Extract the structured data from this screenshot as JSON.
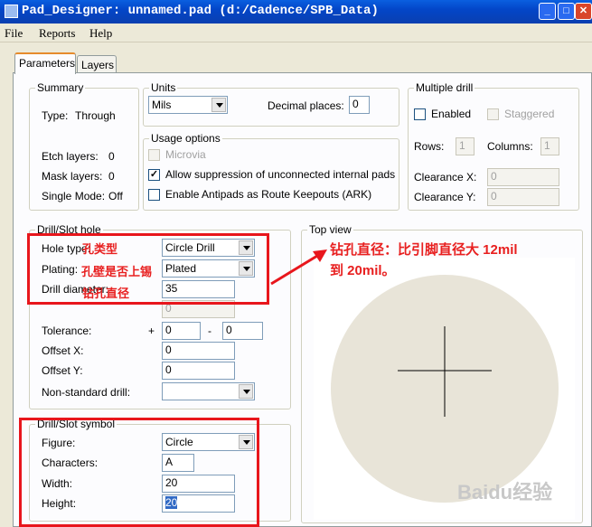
{
  "window": {
    "title": "Pad_Designer: unnamed.pad (d:/Cadence/SPB_Data)",
    "buttons": {
      "minimize": "_",
      "maximize": "□",
      "close": "✕"
    }
  },
  "menu": [
    "File",
    "Reports",
    "Help"
  ],
  "tabs": [
    "Parameters",
    "Layers"
  ],
  "summary": {
    "legend": "Summary",
    "type_label": "Type:",
    "type_value": "Through",
    "etch_label": "Etch layers:",
    "etch_value": "0",
    "mask_label": "Mask layers:",
    "mask_value": "0",
    "single_label": "Single Mode:",
    "single_value": "Off"
  },
  "units": {
    "legend": "Units",
    "unit_value": "Mils",
    "decimal_label": "Decimal places:",
    "decimal_value": "0"
  },
  "usage": {
    "legend": "Usage options",
    "microvia": "Microvia",
    "allow_suppression": "Allow suppression of unconnected internal pads",
    "antipads": "Enable Antipads as Route Keepouts (ARK)",
    "check_mark": "✓"
  },
  "multi": {
    "legend": "Multiple drill",
    "enabled": "Enabled",
    "staggered": "Staggered",
    "rows_label": "Rows:",
    "rows_value": "1",
    "cols_label": "Columns:",
    "cols_value": "1",
    "clrx_label": "Clearance X:",
    "clrx_value": "0",
    "clry_label": "Clearance Y:",
    "clry_value": "0"
  },
  "drill": {
    "legend": "Drill/Slot hole",
    "hole_type_label": "Hole type:",
    "hole_type_value": "Circle Drill",
    "plating_label": "Plating:",
    "plating_value": "Plated",
    "diameter_label": "Drill diameter:",
    "diameter_value": "35",
    "second_value": "0",
    "tolerance_label": "Tolerance:",
    "tol_plus": "+",
    "tol_plus_value": "0",
    "tol_minus": "-",
    "tol_minus_value": "0",
    "offx_label": "Offset X:",
    "offx_value": "0",
    "offy_label": "Offset Y:",
    "offy_value": "0",
    "nonstd_label": "Non-standard drill:",
    "nonstd_value": ""
  },
  "symbol": {
    "legend": "Drill/Slot symbol",
    "figure_label": "Figure:",
    "figure_value": "Circle",
    "chars_label": "Characters:",
    "chars_value": "A",
    "width_label": "Width:",
    "width_value": "20",
    "height_label": "Height:",
    "height_value": "20"
  },
  "topview": {
    "legend": "Top view"
  },
  "annotations": {
    "hole_type": "孔类型",
    "plating": "孔壁是否上锡",
    "diameter": "钻孔直径",
    "note_line1": "钻孔直径：比引脚直径大 12mil",
    "note_line2": "到 20mil。"
  },
  "watermark": "Baidu经验",
  "colors": {
    "annotation": "#e8161c",
    "titlebar": "#0a5fe0",
    "preview": "#e8e4d8"
  }
}
